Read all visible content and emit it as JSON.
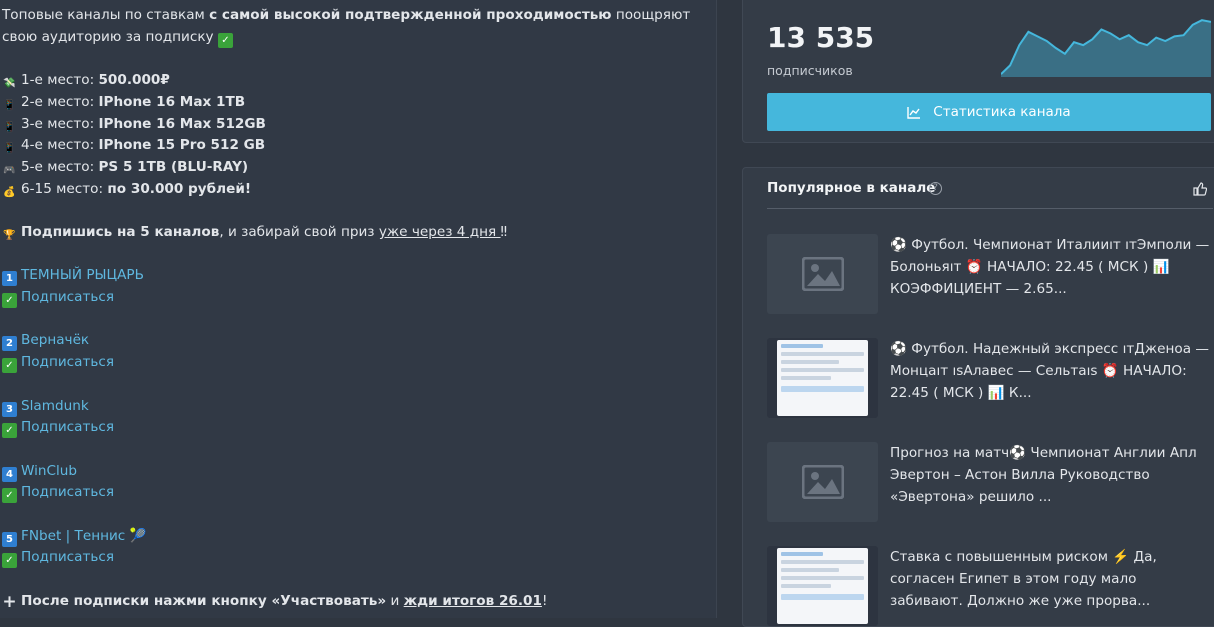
{
  "post": {
    "intro_1": "Топовые каналы по ставкам ",
    "intro_bold": "с самой высокой подтвержденной проходимостью",
    "intro_2": " поощряют свою аудиторию за подписку",
    "prizes": [
      {
        "icon": "💸",
        "label": "1-е место: ",
        "value": "500.000₽"
      },
      {
        "icon": "📱",
        "label": "2-е место: ",
        "value": "IPhone 16 Max 1TB"
      },
      {
        "icon": "📱",
        "label": "3-е место: ",
        "value": "IPhone 16 Max 512GB"
      },
      {
        "icon": "📱",
        "label": "4-е место: ",
        "value": "IPhone 15 Pro 512 GB"
      },
      {
        "icon": "🎮",
        "label": "5-е место: ",
        "value": "PS 5 1TB (BLU-RAY)"
      },
      {
        "icon": "💰",
        "label": "6-15 место: ",
        "value": "по 30.000 рублей!"
      }
    ],
    "cta_bold": "Подпишись на 5 каналов",
    "cta_mid": ", и забирай свой приз ",
    "cta_link": "уже через 4 дня ",
    "cta_end": "‼",
    "channels": [
      {
        "num": "1",
        "name": "ТЕМНЫЙ РЫЦАРЬ",
        "action": "Подписаться"
      },
      {
        "num": "2",
        "name": "Верначёк",
        "action": "Подписаться"
      },
      {
        "num": "3",
        "name": "Slamdunk",
        "action": "Подписаться"
      },
      {
        "num": "4",
        "name": "WinClub",
        "action": "Подписаться"
      },
      {
        "num": "5",
        "name": "FNbet | Теннис 🎾",
        "action": "Подписаться"
      }
    ],
    "final_bold_1": "После подписки нажми кнопку «Участвовать»",
    "final_mid": " и ",
    "final_link": "жди итогов 26.01",
    "final_end": "!"
  },
  "stats": {
    "subscribers": "13 535",
    "subscribers_label": "подписчиков",
    "button_label": "Статистика канала",
    "sparkline": [
      0.05,
      0.2,
      0.55,
      0.78,
      0.7,
      0.62,
      0.5,
      0.4,
      0.6,
      0.55,
      0.65,
      0.82,
      0.75,
      0.65,
      0.72,
      0.6,
      0.55,
      0.68,
      0.62,
      0.7,
      0.72,
      0.9,
      0.98,
      0.95
    ]
  },
  "popular": {
    "title": "Популярное в канале",
    "items": [
      {
        "thumb": "placeholder",
        "text": "⚽️ Футбол. Чемпионат Италииıт ıтЭмполи — Болоньяıт ⏰ НАЧАЛО: 22.45 ( МСК ) 📊 КОЭФФИЦИЕНТ — 2.65..."
      },
      {
        "thumb": "screenshot",
        "text": "⚽️ Футбол. Надежный экспресс ıтДженоа — Монцаıт ısАлавес — Сельтаıs ⏰ НАЧАЛО: 22.45 ( МСК ) 📊 К..."
      },
      {
        "thumb": "placeholder",
        "text": "Прогноз на матч⚽️ Чемпионат Англии Апл Эвертон – Астон Вилла Руководство «Эвертона» решило ..."
      },
      {
        "thumb": "screenshot",
        "text": "Ставка с повышенным риском ⚡️ Да, согласен Египет в этом году мало забивают. Должно же уже прорва..."
      }
    ]
  },
  "colors": {
    "accent": "#45b7dc",
    "link": "#5fb8e0",
    "bg": "#313945"
  }
}
